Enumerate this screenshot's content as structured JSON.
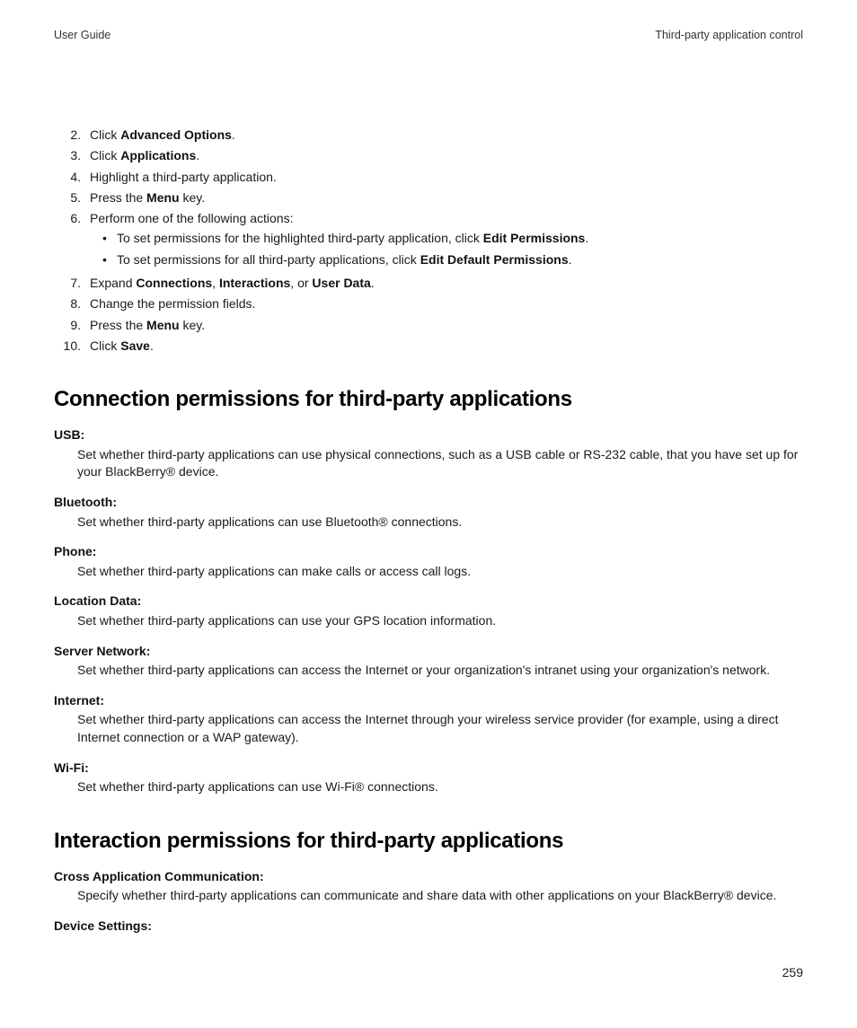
{
  "header": {
    "left": "User Guide",
    "right": "Third-party application control"
  },
  "steps": [
    {
      "n": "2.",
      "pre": "Click ",
      "bold": "Advanced Options",
      "post": "."
    },
    {
      "n": "3.",
      "pre": "Click ",
      "bold": "Applications",
      "post": "."
    },
    {
      "n": "4.",
      "pre": "Highlight a third-party application.",
      "bold": "",
      "post": ""
    },
    {
      "n": "5.",
      "pre": "Press the ",
      "bold": "Menu",
      "post": " key."
    },
    {
      "n": "6.",
      "pre": "Perform one of the following actions:",
      "bold": "",
      "post": "",
      "sub": [
        {
          "pre": "To set permissions for the highlighted third-party application, click ",
          "bold": "Edit Permissions",
          "post": "."
        },
        {
          "pre": "To set permissions for all third-party applications, click ",
          "bold": "Edit Default Permissions",
          "post": "."
        }
      ]
    },
    {
      "n": "7.",
      "pre": "Expand ",
      "multi": [
        {
          "b": "Connections"
        },
        {
          "t": ", "
        },
        {
          "b": "Interactions"
        },
        {
          "t": ", or "
        },
        {
          "b": "User Data"
        },
        {
          "t": "."
        }
      ]
    },
    {
      "n": "8.",
      "pre": "Change the permission fields.",
      "bold": "",
      "post": ""
    },
    {
      "n": "9.",
      "pre": "Press the ",
      "bold": "Menu",
      "post": " key."
    },
    {
      "n": "10.",
      "pre": "Click ",
      "bold": "Save",
      "post": "."
    }
  ],
  "section1": {
    "title": "Connection permissions for third-party applications",
    "items": [
      {
        "term": "USB:",
        "desc": "Set whether third-party applications can use physical connections, such as a USB cable or RS-232 cable, that you have set up for your BlackBerry® device."
      },
      {
        "term": "Bluetooth:",
        "desc": "Set whether third-party applications can use Bluetooth® connections."
      },
      {
        "term": "Phone:",
        "desc": "Set whether third-party applications can make calls or access call logs."
      },
      {
        "term": "Location Data:",
        "desc": "Set whether third-party applications can use your GPS location information."
      },
      {
        "term": "Server Network:",
        "desc": "Set whether third-party applications can access the Internet or your organization's intranet using your organization's network."
      },
      {
        "term": "Internet:",
        "desc": "Set whether third-party applications can access the Internet through your wireless service provider (for example, using a direct Internet connection or a WAP gateway)."
      },
      {
        "term": "Wi-Fi:",
        "desc": "Set whether third-party applications can use Wi-Fi® connections."
      }
    ]
  },
  "section2": {
    "title": "Interaction permissions for third-party applications",
    "items": [
      {
        "term": "Cross Application Communication:",
        "desc": "Specify whether third-party applications can communicate and share data with other applications on your BlackBerry® device."
      },
      {
        "term": "Device Settings:",
        "desc": ""
      }
    ]
  },
  "pageNumber": "259"
}
